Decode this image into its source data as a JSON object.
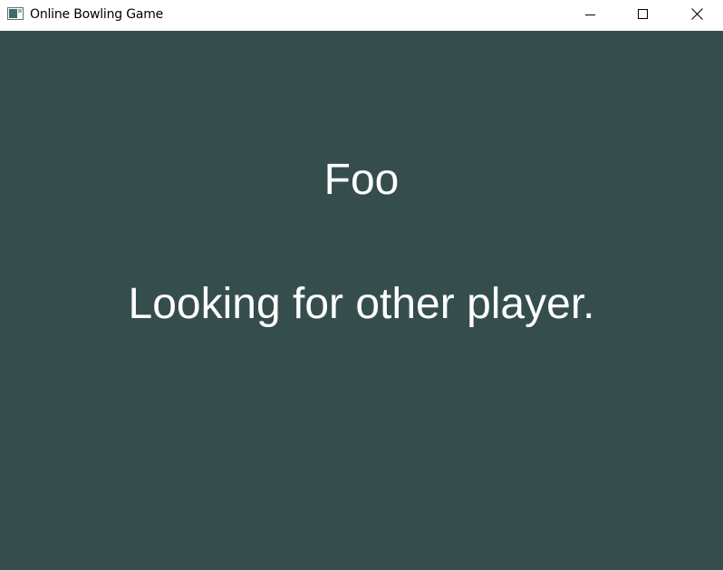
{
  "window": {
    "title": "Online Bowling Game",
    "icon": "app-window-icon",
    "controls": [
      "minimize-icon",
      "maximize-icon",
      "close-icon"
    ]
  },
  "game": {
    "player_name": "Foo",
    "status": "Looking for other player."
  },
  "colors": {
    "background": "#354e4d",
    "text": "#ffffff",
    "titlebar": "#ffffff"
  }
}
